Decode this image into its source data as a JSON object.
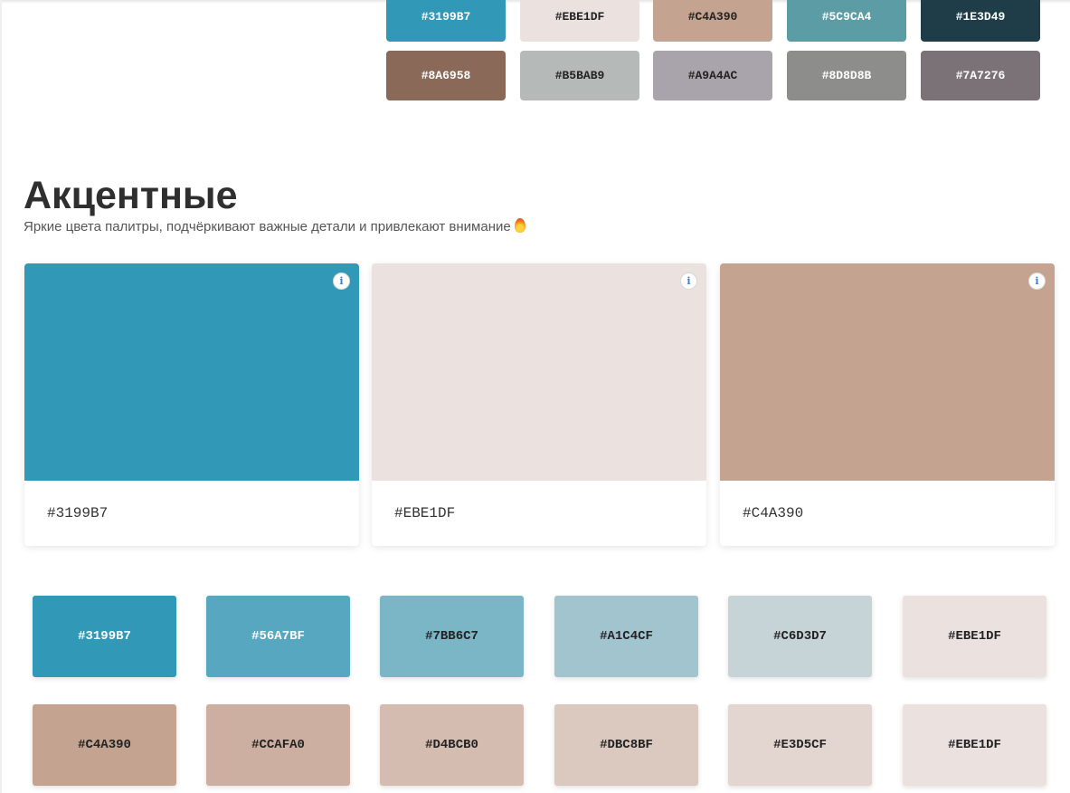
{
  "top_palette": [
    {
      "hex": "#3199B7",
      "color": "#3199B7",
      "text_color": "#ffffff"
    },
    {
      "hex": "#EBE1DF",
      "color": "#EBE1DF",
      "text_color": "#222222"
    },
    {
      "hex": "#C4A390",
      "color": "#C4A390",
      "text_color": "#222222"
    },
    {
      "hex": "#5C9CA4",
      "color": "#5C9CA4",
      "text_color": "#ffffff"
    },
    {
      "hex": "#1E3D49",
      "color": "#1E3D49",
      "text_color": "#ffffff"
    },
    {
      "hex": "#8A6958",
      "color": "#8A6958",
      "text_color": "#ffffff"
    },
    {
      "hex": "#B5BAB9",
      "color": "#B5BAB9",
      "text_color": "#222222"
    },
    {
      "hex": "#A9A4AC",
      "color": "#A9A4AC",
      "text_color": "#222222"
    },
    {
      "hex": "#8D8D8B",
      "color": "#8D8D8B",
      "text_color": "#ffffff"
    },
    {
      "hex": "#7A7276",
      "color": "#7A7276",
      "text_color": "#ffffff"
    }
  ],
  "accent_section": {
    "title": "Акцентные",
    "subtitle": "Яркие цвета палитры, подчёркивают важные детали и привлекают внимание",
    "cards": [
      {
        "hex": "#3199B7",
        "color": "#3199B7"
      },
      {
        "hex": "#EBE1DF",
        "color": "#EBE1DF"
      },
      {
        "hex": "#C4A390",
        "color": "#C4A390"
      }
    ],
    "info_icon_glyph": "i"
  },
  "shade_rows": [
    [
      {
        "hex": "#3199B7",
        "color": "#3199B7",
        "text_color": "#ffffff"
      },
      {
        "hex": "#56A7BF",
        "color": "#56A7BF",
        "text_color": "#ffffff"
      },
      {
        "hex": "#7BB6C7",
        "color": "#7BB6C7",
        "text_color": "#222222"
      },
      {
        "hex": "#A1C4CF",
        "color": "#A1C4CF",
        "text_color": "#222222"
      },
      {
        "hex": "#C6D3D7",
        "color": "#C6D3D7",
        "text_color": "#222222"
      },
      {
        "hex": "#EBE1DF",
        "color": "#EBE1DF",
        "text_color": "#222222"
      }
    ],
    [
      {
        "hex": "#C4A390",
        "color": "#C4A390",
        "text_color": "#222222"
      },
      {
        "hex": "#CCAFA0",
        "color": "#CCAFA0",
        "text_color": "#222222"
      },
      {
        "hex": "#D4BCB0",
        "color": "#D4BCB0",
        "text_color": "#222222"
      },
      {
        "hex": "#DBC8BF",
        "color": "#DBC8BF",
        "text_color": "#222222"
      },
      {
        "hex": "#E3D5CF",
        "color": "#E3D5CF",
        "text_color": "#222222"
      },
      {
        "hex": "#EBE1DF",
        "color": "#EBE1DF",
        "text_color": "#222222"
      }
    ]
  ]
}
